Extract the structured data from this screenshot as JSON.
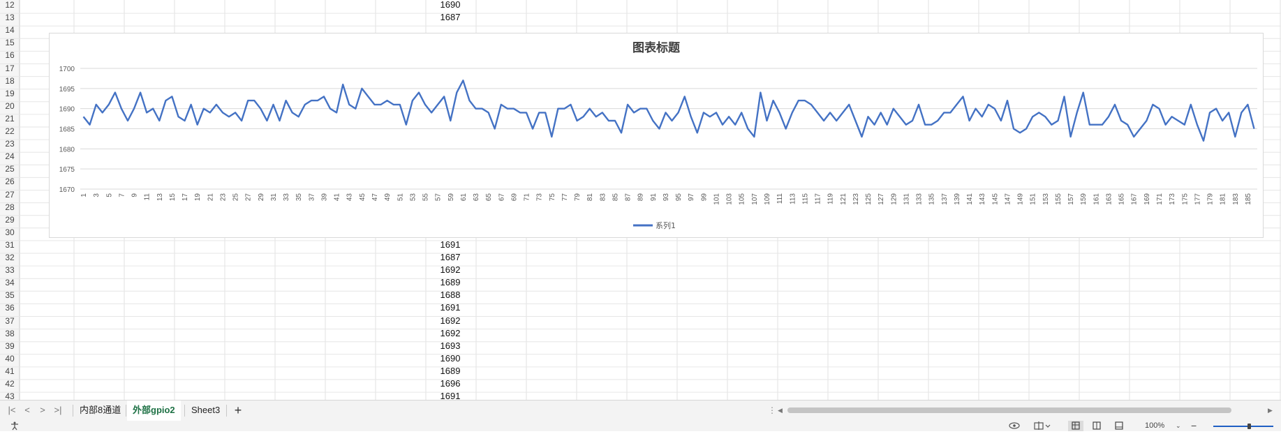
{
  "row_numbers": [
    "12",
    "13",
    "14",
    "15",
    "16",
    "17",
    "18",
    "19",
    "20",
    "21",
    "22",
    "23",
    "24",
    "25",
    "26",
    "27",
    "28",
    "29",
    "30",
    "31",
    "32",
    "33",
    "34",
    "35",
    "36",
    "37",
    "38",
    "39",
    "40",
    "41",
    "42",
    "43"
  ],
  "cell_values": [
    {
      "row": "12",
      "value": "1690"
    },
    {
      "row": "13",
      "value": "1687"
    },
    {
      "row": "31",
      "value": "1691"
    },
    {
      "row": "32",
      "value": "1687"
    },
    {
      "row": "33",
      "value": "1692"
    },
    {
      "row": "34",
      "value": "1689"
    },
    {
      "row": "35",
      "value": "1688"
    },
    {
      "row": "36",
      "value": "1691"
    },
    {
      "row": "37",
      "value": "1692"
    },
    {
      "row": "38",
      "value": "1692"
    },
    {
      "row": "39",
      "value": "1693"
    },
    {
      "row": "40",
      "value": "1690"
    },
    {
      "row": "41",
      "value": "1689"
    },
    {
      "row": "42",
      "value": "1696"
    },
    {
      "row": "43",
      "value": "1691"
    }
  ],
  "chart_data": {
    "type": "line",
    "title": "图表标题",
    "xlabel": "",
    "ylabel": "",
    "ylim": [
      1670,
      1700
    ],
    "yticks": [
      1670,
      1675,
      1680,
      1685,
      1690,
      1695,
      1700
    ],
    "x": [
      1,
      2,
      3,
      4,
      5,
      6,
      7,
      8,
      9,
      10,
      11,
      12,
      13,
      14,
      15,
      16,
      17,
      18,
      19,
      20,
      21,
      22,
      23,
      24,
      25,
      26,
      27,
      28,
      29,
      30,
      31,
      32,
      33,
      34,
      35,
      36,
      37,
      38,
      39,
      40,
      41,
      42,
      43,
      44,
      45,
      46,
      47,
      48,
      49,
      50,
      51,
      52,
      53,
      54,
      55,
      56,
      57,
      58,
      59,
      60,
      61,
      62,
      63,
      64,
      65,
      66,
      67,
      68,
      69,
      70,
      71,
      72,
      73,
      74,
      75,
      76,
      77,
      78,
      79,
      80,
      81,
      82,
      83,
      84,
      85,
      86,
      87,
      88,
      89,
      90,
      91,
      92,
      93,
      94,
      95,
      96,
      97,
      98,
      99,
      100,
      101,
      102,
      103,
      104,
      105,
      106,
      107,
      108,
      109,
      110,
      111,
      112,
      113,
      114,
      115,
      116,
      117,
      118,
      119,
      120,
      121,
      122,
      123,
      124,
      125,
      126,
      127,
      128,
      129,
      130,
      131,
      132,
      133,
      134,
      135,
      136,
      137,
      138,
      139,
      140,
      141,
      142,
      143,
      144,
      145,
      146,
      147,
      148,
      149,
      150,
      151,
      152,
      153,
      154,
      155,
      156,
      157,
      158,
      159,
      160,
      161,
      162,
      163,
      164,
      165,
      166,
      167,
      168,
      169,
      170,
      171,
      172,
      173,
      174,
      175,
      176,
      177,
      178,
      179,
      180,
      181,
      182,
      183,
      184,
      185,
      186
    ],
    "series": [
      {
        "name": "系列1",
        "color": "#4472c4",
        "values": [
          1688,
          1686,
          1691,
          1689,
          1691,
          1694,
          1690,
          1687,
          1690,
          1694,
          1689,
          1690,
          1687,
          1692,
          1693,
          1688,
          1687,
          1691,
          1686,
          1690,
          1689,
          1691,
          1689,
          1688,
          1689,
          1687,
          1692,
          1692,
          1690,
          1687,
          1691,
          1687,
          1692,
          1689,
          1688,
          1691,
          1692,
          1692,
          1693,
          1690,
          1689,
          1696,
          1691,
          1690,
          1695,
          1693,
          1691,
          1691,
          1692,
          1691,
          1691,
          1686,
          1692,
          1694,
          1691,
          1689,
          1691,
          1693,
          1687,
          1694,
          1697,
          1692,
          1690,
          1690,
          1689,
          1685,
          1691,
          1690,
          1690,
          1689,
          1689,
          1685,
          1689,
          1689,
          1683,
          1690,
          1690,
          1691,
          1687,
          1688,
          1690,
          1688,
          1689,
          1687,
          1687,
          1684,
          1691,
          1689,
          1690,
          1690,
          1687,
          1685,
          1689,
          1687,
          1689,
          1693,
          1688,
          1684,
          1689,
          1688,
          1689,
          1686,
          1688,
          1686,
          1689,
          1685,
          1683,
          1694,
          1687,
          1692,
          1689,
          1685,
          1689,
          1692,
          1692,
          1691,
          1689,
          1687,
          1689,
          1687,
          1689,
          1691,
          1687,
          1683,
          1688,
          1686,
          1689,
          1686,
          1690,
          1688,
          1686,
          1687,
          1691,
          1686,
          1686,
          1687,
          1689,
          1689,
          1691,
          1693,
          1687,
          1690,
          1688,
          1691,
          1690,
          1687,
          1692,
          1685,
          1684,
          1685,
          1688,
          1689,
          1688,
          1686,
          1687,
          1693,
          1683,
          1689,
          1694,
          1686,
          1686,
          1686,
          1688,
          1691,
          1687,
          1686,
          1683,
          1685,
          1687,
          1691,
          1690,
          1686,
          1688,
          1687,
          1686,
          1691,
          1686,
          1682,
          1689,
          1690,
          1687,
          1689,
          1683,
          1689,
          1691,
          1685
        ]
      }
    ],
    "legend": "bottom",
    "grid": true
  },
  "sheet_tabs": [
    {
      "label": "内部8通道",
      "active": false
    },
    {
      "label": "外部gpio2",
      "active": true
    },
    {
      "label": "Sheet3",
      "active": false
    }
  ],
  "add_sheet_label": "+",
  "nav_buttons": [
    "|<",
    "<",
    ">",
    ">|"
  ],
  "status": {
    "zoom": "100%"
  }
}
